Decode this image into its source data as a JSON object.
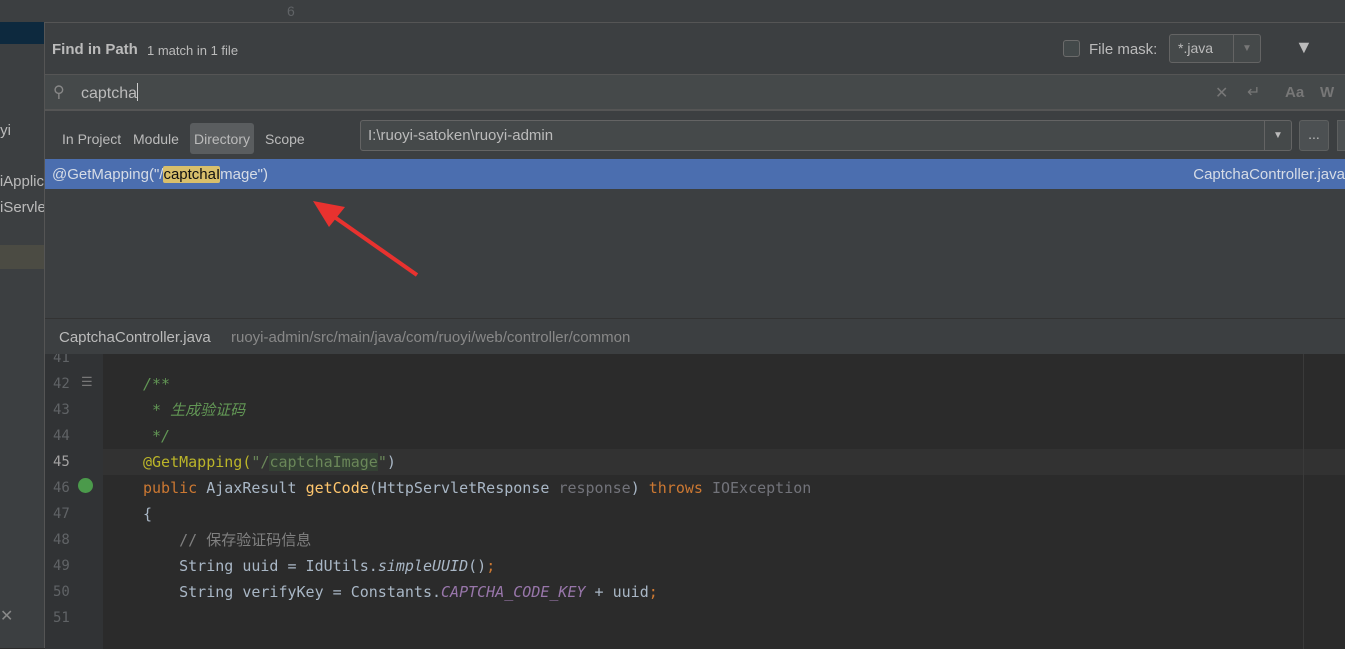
{
  "background": {
    "line_number": "6",
    "side_items": [
      "yi",
      "iApplic",
      "iServle"
    ]
  },
  "dialog": {
    "title": "Find in Path",
    "match_count": "1 match in 1 file",
    "file_mask_label": "File mask:",
    "file_mask_value": "*.java",
    "file_mask_checked": false,
    "search_query": "captcha",
    "option_match_case": "Aa",
    "option_words": "W",
    "scopes": [
      "In Project",
      "Module",
      "Directory",
      "Scope"
    ],
    "selected_scope": "Directory",
    "directory": "I:\\ruoyi-satoken\\ruoyi-admin",
    "browse_label": "...",
    "results": [
      {
        "prefix": "@GetMapping(\"/",
        "match": "captchaI",
        "suffix": "mage\")",
        "file": "CaptchaController.java"
      }
    ]
  },
  "preview": {
    "file": "CaptchaController.java",
    "path": "ruoyi-admin/src/main/java/com/ruoyi/web/controller/common",
    "current_line": "45",
    "lines": [
      {
        "n": "41",
        "t": ""
      },
      {
        "n": "42",
        "t": "/**"
      },
      {
        "n": "43",
        "t": " * 生成验证码"
      },
      {
        "n": "44",
        "t": " */"
      },
      {
        "n": "45",
        "a": "@GetMapping(",
        "s1": "\"/",
        "s2": "captchaImage",
        "s3": "\"",
        ")": ")"
      },
      {
        "n": "46",
        "kw1": "public",
        "t1": " AjaxResult ",
        "fn": "getCode",
        "t2": "(HttpServletResponse ",
        "par": "response",
        "t3": ") ",
        "kw2": "throws",
        "t4": " IOException"
      },
      {
        "n": "47",
        "t": "{"
      },
      {
        "n": "48",
        "t": "    // 保存验证码信息"
      },
      {
        "n": "49",
        "t1": "    String uuid = IdUtils.",
        "it": "simpleUUID",
        "t2": "()",
        ";": ";"
      },
      {
        "n": "50",
        "t1": "    String verifyKey = Constants.",
        "c": "CAPTCHA_CODE_KEY",
        "t2": " + uuid",
        ";": ";"
      },
      {
        "n": "51",
        "t": ""
      }
    ]
  },
  "colors": {
    "selection": "#4b6eaf",
    "match_highlight": "#d8bf6b",
    "annotation": "#bbb529",
    "keyword": "#cc7832",
    "arrow": "#e8322f"
  }
}
